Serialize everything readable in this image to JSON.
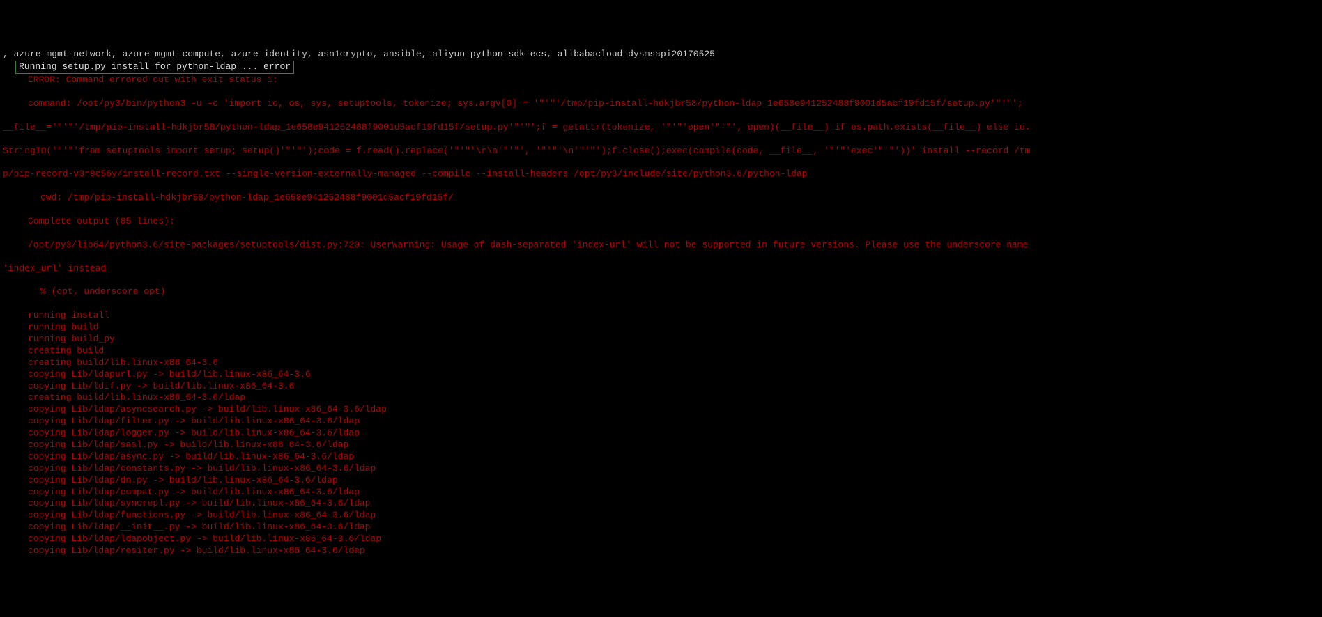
{
  "pkg_line": ", azure-mgmt-network, azure-mgmt-compute, azure-identity, asn1crypto, ansible, aliyun-python-sdk-ecs, alibabacloud-dysmsapi20170525",
  "running_line": "Running setup.py install for python-ldap ... error",
  "error_header": "ERROR: Command errored out with exit status 1:",
  "command_label": "command: ",
  "command_seg1": "/opt/py3/bin/python3 -u -c 'import io, os, sys, setuptools, tokenize; sys.argv[0] = '\"'\"'/tmp/pip-install-hdkjbr58/python-ldap_1e658e941252488f9001d5acf19fd15f/setup.py'\"'\"';",
  "command_seg2": "__file__='\"'\"'/tmp/pip-install-hdkjbr58/python-ldap_1e658e941252488f9001d5acf19fd15f/setup.py'\"'\"';f = getattr(tokenize, '\"'\"'open'\"'\"', open)(__file__) if os.path.exists(__file__) else io.",
  "command_seg3": "StringIO('\"'\"'from setuptools import setup; setup()'\"'\"');code = f.read().replace('\"'\"'\\r\\n'\"'\"', '\"'\"'\\n'\"'\"');f.close();exec(compile(code, __file__, '\"'\"'exec'\"'\"'))' install --record /tm",
  "command_seg4": "p/pip-record-v3r9c56y/install-record.txt --single-version-externally-managed --compile --install-headers /opt/py3/include/site/python3.6/python-ldap",
  "cwd_line": "cwd: /tmp/pip-install-hdkjbr58/python-ldap_1e658e941252488f9001d5acf19fd15f/",
  "complete_output": "Complete output (85 lines):",
  "userwarning_1": "/opt/py3/lib64/python3.6/site-packages/setuptools/dist.py:720: UserWarning: Usage of dash-separated 'index-url' will not be supported in future versions. Please use the underscore name ",
  "userwarning_2": "'index_url' instead",
  "pct_line": "% (opt, underscore_opt)",
  "build_lines": [
    "running install",
    "running build",
    "running build_py",
    "creating build",
    "creating build/lib.linux-x86_64-3.6",
    "copying Lib/ldapurl.py -> build/lib.linux-x86_64-3.6",
    "copying Lib/ldif.py -> build/lib.linux-x86_64-3.6",
    "creating build/lib.linux-x86_64-3.6/ldap",
    "copying Lib/ldap/asyncsearch.py -> build/lib.linux-x86_64-3.6/ldap",
    "copying Lib/ldap/filter.py -> build/lib.linux-x86_64-3.6/ldap",
    "copying Lib/ldap/logger.py -> build/lib.linux-x86_64-3.6/ldap",
    "copying Lib/ldap/sasl.py -> build/lib.linux-x86_64-3.6/ldap",
    "copying Lib/ldap/async.py -> build/lib.linux-x86_64-3.6/ldap",
    "copying Lib/ldap/constants.py -> build/lib.linux-x86_64-3.6/ldap",
    "copying Lib/ldap/dn.py -> build/lib.linux-x86_64-3.6/ldap",
    "copying Lib/ldap/compat.py -> build/lib.linux-x86_64-3.6/ldap",
    "copying Lib/ldap/syncrepl.py -> build/lib.linux-x86_64-3.6/ldap",
    "copying Lib/ldap/functions.py -> build/lib.linux-x86_64-3.6/ldap",
    "copying Lib/ldap/__init__.py -> build/lib.linux-x86_64-3.6/ldap",
    "copying Lib/ldap/ldapobject.py -> build/lib.linux-x86_64-3.6/ldap",
    "copying Lib/ldap/resiter.py -> build/lib.linux-x86_64-3.6/ldap"
  ]
}
